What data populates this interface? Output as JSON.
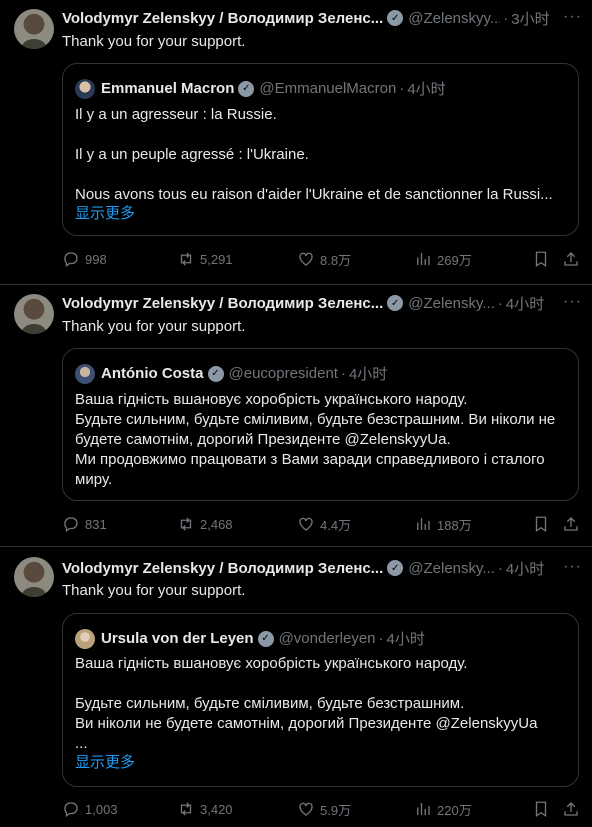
{
  "tweets": [
    {
      "author": "Volodymyr Zelenskyy / Володимир Зеленс...",
      "handle": "@Zelenskyy...",
      "time": "3小时",
      "text": "Thank you for your support.",
      "quote": {
        "author": "Emmanuel Macron",
        "handle": "@EmmanuelMacron",
        "time": "4小时",
        "body": "Il y a un agresseur : la Russie.\n\nIl y a un peuple agressé : l'Ukraine.\n\nNous avons tous eu raison d'aider l'Ukraine et de sanctionner la Russi...",
        "show_more": "显示更多"
      },
      "replies": "998",
      "retweets": "5,291",
      "likes": "8.8万",
      "views": "269万"
    },
    {
      "author": "Volodymyr Zelenskyy / Володимир Зеленс...",
      "handle": "@Zelensky...",
      "time": "4小时",
      "text": "Thank you for your support.",
      "quote": {
        "author": "António Costa",
        "handle": "@eucopresident",
        "time": "4小时",
        "body": "Ваша гідність вшановує хоробрість українського народу.\nБудьте сильним, будьте сміливим, будьте безстрашним. Ви ніколи не будете самотнім, дорогий Президенте @ZelenskyyUa.\nМи продовжимо працювати з Вами заради справедливого і сталого миру."
      },
      "replies": "831",
      "retweets": "2,468",
      "likes": "4.4万",
      "views": "188万"
    },
    {
      "author": "Volodymyr Zelenskyy / Володимир Зеленс...",
      "handle": "@Zelensky...",
      "time": "4小时",
      "text": "Thank you for your support.",
      "quote": {
        "author": "Ursula von der Leyen",
        "handle": "@vonderleyen",
        "time": "4小时",
        "body": "Ваша гідність вшановує хоробрість українського народу.\n\nБудьте сильним, будьте сміливим, будьте безстрашним.\nВи ніколи не будете самотнім, дорогий Президенте @ZelenskyyUa\n...",
        "show_more": "显示更多"
      },
      "replies": "1,003",
      "retweets": "3,420",
      "likes": "5.9万",
      "views": "220万"
    }
  ],
  "colors": {
    "background": "#000000",
    "text": "#e7e9ea",
    "muted": "#71767b",
    "link": "#1d9bf0",
    "border": "#2f3336"
  },
  "icons": {
    "verified": "verified-badge-icon",
    "reply": "reply-icon",
    "retweet": "retweet-icon",
    "like": "heart-icon",
    "views": "views-chart-icon",
    "bookmark": "bookmark-icon",
    "share": "share-icon",
    "more": "more-dots-icon"
  }
}
